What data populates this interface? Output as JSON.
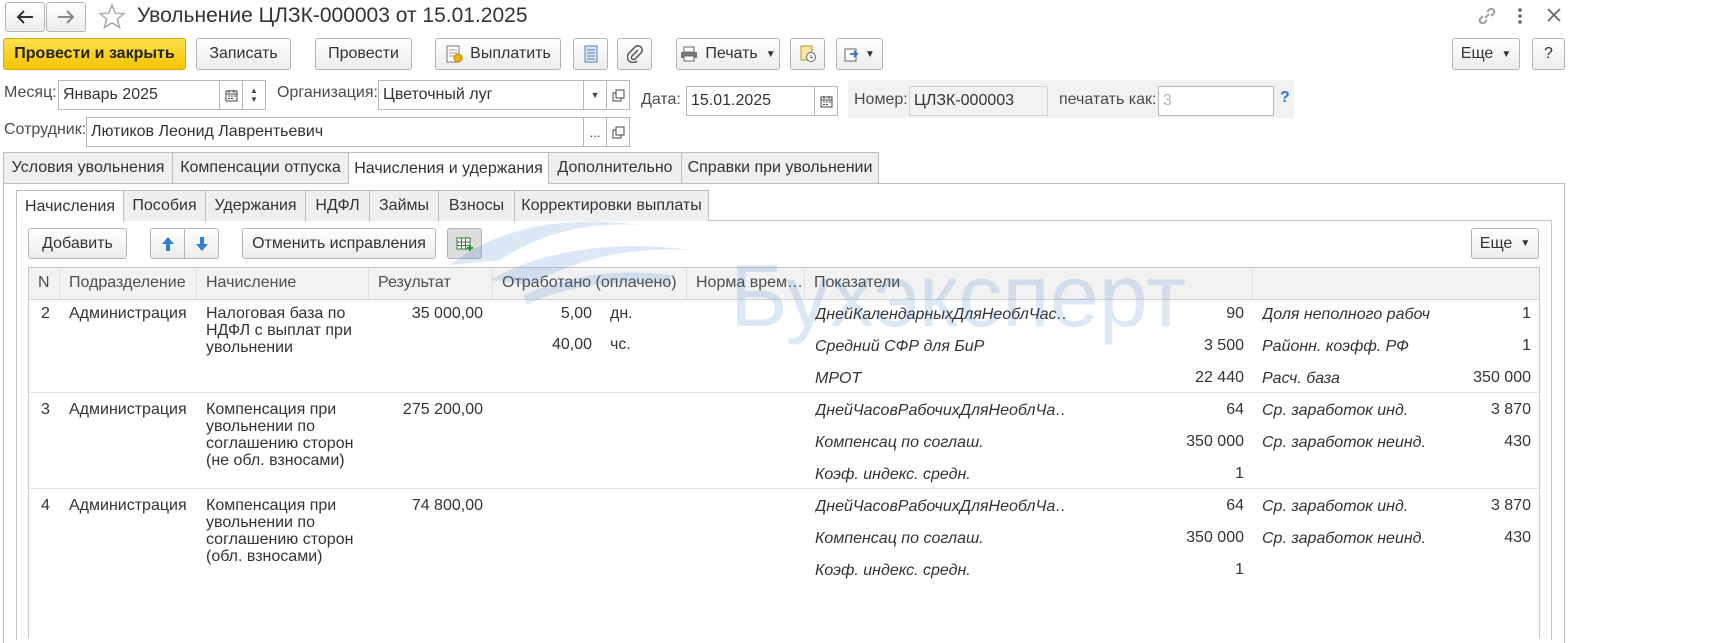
{
  "window": {
    "title": "Увольнение ЦЛЗК-000003 от 15.01.2025"
  },
  "toolbar": {
    "post_close": "Провести и закрыть",
    "save": "Записать",
    "post": "Провести",
    "pay": "Выплатить",
    "print": "Печать",
    "more": "Еще",
    "help": "?"
  },
  "form": {
    "month_label": "Месяц:",
    "month_value": "Январь 2025",
    "org_label": "Организация:",
    "org_value": "Цветочный луг",
    "date_label": "Дата:",
    "date_value": "15.01.2025",
    "number_label": "Номер:",
    "number_value": "ЦЛЗК-000003",
    "print_as_label": "печатать как:",
    "print_as_placeholder": "3",
    "help": "?",
    "employee_label": "Сотрудник:",
    "employee_value": "Лютиков Леонид Лаврентьевич"
  },
  "main_tabs": [
    "Условия увольнения",
    "Компенсации отпуска",
    "Начисления и удержания",
    "Дополнительно",
    "Справки при увольнении"
  ],
  "sub_tabs": [
    "Начисления",
    "Пособия",
    "Удержания",
    "НДФЛ",
    "Займы",
    "Взносы",
    "Корректировки выплаты"
  ],
  "table_toolbar": {
    "add": "Добавить",
    "cancel_fixes": "Отменить исправления",
    "more": "Еще"
  },
  "watermark": "Бухэксперт",
  "table": {
    "columns": [
      "N",
      "Подразделение",
      "Начисление",
      "Результат",
      "Отработано (оплачено)",
      "Норма врем…",
      "Показатели"
    ],
    "rows": [
      {
        "n": "2",
        "dept": "Администрация",
        "accrual": [
          "Налоговая база по",
          "НДФЛ с выплат при",
          "увольнении"
        ],
        "result": "35 000,00",
        "worked": [
          {
            "value": "5,00",
            "unit": "дн."
          },
          {
            "value": "40,00",
            "unit": "чс."
          }
        ],
        "indicators": [
          {
            "l_name": "ДнейКалендарныхДляНеоблЧас…",
            "l_val": "90",
            "r_name": "Доля неполного рабоч",
            "r_val": "1"
          },
          {
            "l_name": "Средний СФР для БиР",
            "l_val": "3 500",
            "r_name": "Районн. коэфф. РФ",
            "r_val": "1"
          },
          {
            "l_name": "МРОТ",
            "l_val": "22 440",
            "r_name": "Расч. база",
            "r_val": "350 000"
          }
        ]
      },
      {
        "n": "3",
        "dept": "Администрация",
        "accrual": [
          "Компенсация при",
          "увольнении по",
          "соглашению сторон",
          "(не обл. взносами)"
        ],
        "result": "275 200,00",
        "worked": [],
        "indicators": [
          {
            "l_name": "ДнейЧасовРабочихДляНеоблЧа…",
            "l_val": "64",
            "r_name": "Ср. заработок инд.",
            "r_val": "3 870"
          },
          {
            "l_name": "Компенсац по соглаш.",
            "l_val": "350 000",
            "r_name": "Ср. заработок неинд.",
            "r_val": "430"
          },
          {
            "l_name": "Коэф. индекс. средн.",
            "l_val": "1",
            "r_name": "",
            "r_val": ""
          }
        ]
      },
      {
        "n": "4",
        "dept": "Администрация",
        "accrual": [
          "Компенсация при",
          "увольнении по",
          "соглашению сторон",
          "(обл. взносами)"
        ],
        "result": "74 800,00",
        "worked": [],
        "indicators": [
          {
            "l_name": "ДнейЧасовРабочихДляНеоблЧа…",
            "l_val": "64",
            "r_name": "Ср. заработок инд.",
            "r_val": "3 870"
          },
          {
            "l_name": "Компенсац по соглаш.",
            "l_val": "350 000",
            "r_name": "Ср. заработок неинд.",
            "r_val": "430"
          },
          {
            "l_name": "Коэф. индекс. средн.",
            "l_val": "1",
            "r_name": "",
            "r_val": ""
          }
        ]
      }
    ]
  }
}
